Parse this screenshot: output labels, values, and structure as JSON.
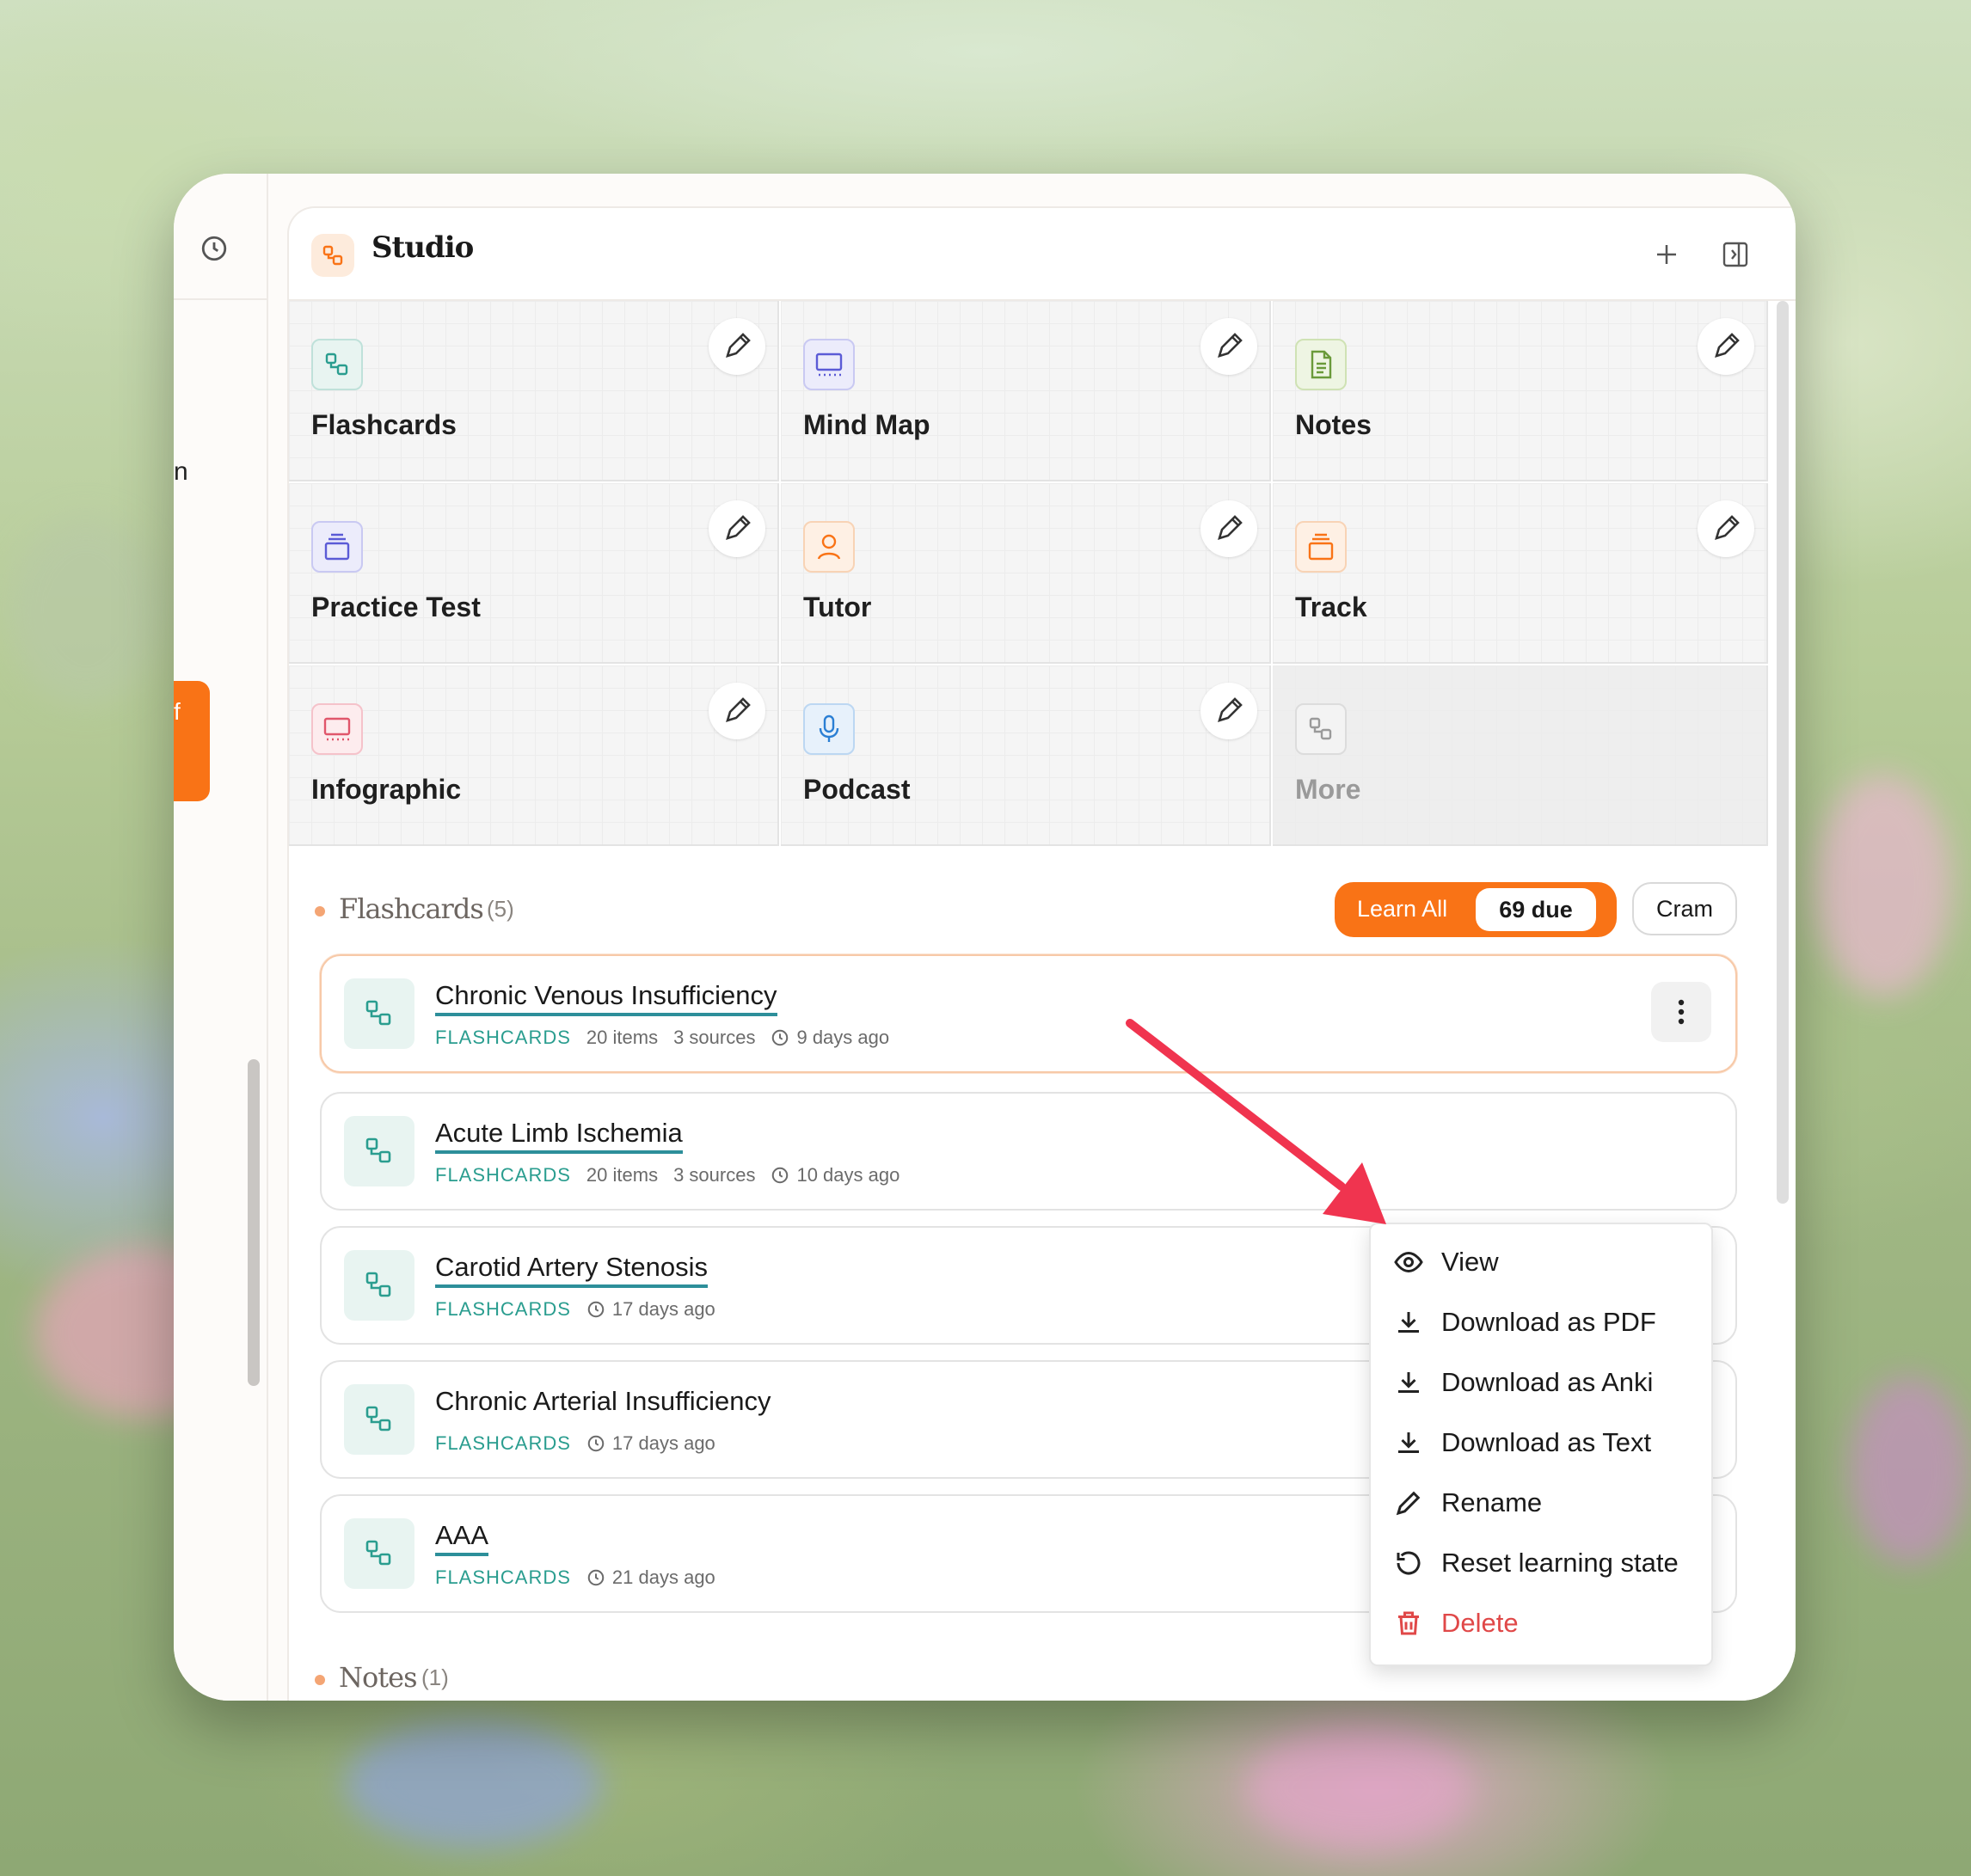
{
  "side": {
    "partial_text": "n",
    "orange_text": "f"
  },
  "header": {
    "title": "Studio"
  },
  "tools": [
    {
      "label": "Flashcards",
      "color": "#2a9d8f"
    },
    {
      "label": "Mind Map",
      "color": "#5b5bd6"
    },
    {
      "label": "Notes",
      "color": "#6a9a3a"
    },
    {
      "label": "Practice Test",
      "color": "#5b5bd6"
    },
    {
      "label": "Tutor",
      "color": "#f97316"
    },
    {
      "label": "Track",
      "color": "#f97316"
    },
    {
      "label": "Infographic",
      "color": "#e0566b"
    },
    {
      "label": "Podcast",
      "color": "#2b7fd4"
    },
    {
      "label": "More",
      "color": "#9a9a9a"
    }
  ],
  "flashcards_section": {
    "title": "Flashcards",
    "count": "(5)",
    "learn_all": "Learn All",
    "due": "69 due",
    "cram": "Cram"
  },
  "cards": [
    {
      "title": "Chronic Venous Insufficiency",
      "type": "FLASHCARDS",
      "items": "20 items",
      "sources": "3 sources",
      "time": "9 days ago"
    },
    {
      "title": "Acute Limb Ischemia",
      "type": "FLASHCARDS",
      "items": "20 items",
      "sources": "3 sources",
      "time": "10 days ago"
    },
    {
      "title": "Carotid Artery Stenosis",
      "type": "FLASHCARDS",
      "time": "17 days ago"
    },
    {
      "title": "Chronic Arterial Insufficiency",
      "type": "FLASHCARDS",
      "time": "17 days ago"
    },
    {
      "title": "AAA",
      "type": "FLASHCARDS",
      "time": "21 days ago"
    }
  ],
  "menu": {
    "items": [
      "View",
      "Download as PDF",
      "Download as Anki",
      "Download as Text",
      "Rename",
      "Reset learning state",
      "Delete"
    ]
  },
  "notes_section": {
    "title": "Notes",
    "count": "(1)"
  },
  "colors": {
    "accent": "#f97316",
    "teal": "#2a9d8f",
    "danger": "#e04848",
    "arrow": "#f0344f"
  }
}
